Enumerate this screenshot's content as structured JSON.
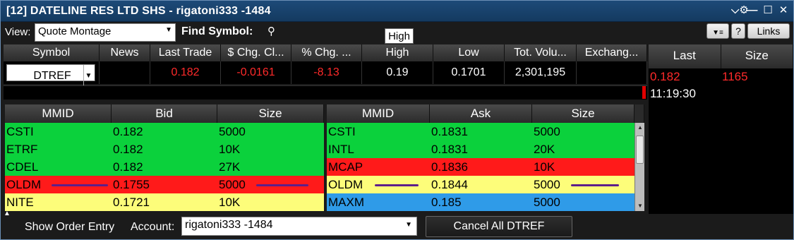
{
  "window": {
    "title": "[12] DATELINE RES LTD SHS - rigatoni333 -1484",
    "controls": [
      "gear-dropdown",
      "minimize",
      "maximize",
      "close"
    ]
  },
  "toolbar": {
    "view_label": "View:",
    "view_value": "Quote Montage",
    "find_label": "Find Symbol:",
    "help_label": "?",
    "links_label": "Links",
    "tooltip": "High"
  },
  "quote": {
    "headers": [
      "Symbol",
      "News",
      "Last Trade",
      "$ Chg. Cl...",
      "% Chg. ...",
      "High",
      "Low",
      "Tot. Volu...",
      "Exchang..."
    ],
    "symbol": "DTREF",
    "news": "",
    "last_trade": "0.182",
    "chg_dollar": "-0.0161",
    "chg_pct": "-8.13",
    "high": "0.19",
    "low": "0.1701",
    "volume": "2,301,195",
    "exchange": ""
  },
  "time_sales": {
    "headers": [
      "Last",
      "Size"
    ],
    "last": "0.182",
    "size": "1165",
    "time": "11:19:30"
  },
  "bid_table": {
    "headers": [
      "MMID",
      "Bid",
      "Size"
    ],
    "rows": [
      {
        "mmid": "CSTI",
        "price": "0.182",
        "size": "5000",
        "color": "green"
      },
      {
        "mmid": "ETRF",
        "price": "0.182",
        "size": "10K",
        "color": "green"
      },
      {
        "mmid": "CDEL",
        "price": "0.182",
        "size": "27K",
        "color": "green"
      },
      {
        "mmid": "OLDM",
        "price": "0.1755",
        "size": "5000",
        "color": "red"
      },
      {
        "mmid": "NITE",
        "price": "0.1721",
        "size": "10K",
        "color": "yellow"
      }
    ]
  },
  "ask_table": {
    "headers": [
      "MMID",
      "Ask",
      "Size"
    ],
    "rows": [
      {
        "mmid": "CSTI",
        "price": "0.1831",
        "size": "5000",
        "color": "green"
      },
      {
        "mmid": "INTL",
        "price": "0.1831",
        "size": "20K",
        "color": "green"
      },
      {
        "mmid": "MCAP",
        "price": "0.1836",
        "size": "10K",
        "color": "red"
      },
      {
        "mmid": "OLDM",
        "price": "0.1844",
        "size": "5000",
        "color": "yellow"
      },
      {
        "mmid": "MAXM",
        "price": "0.185",
        "size": "5000",
        "color": "blue"
      }
    ]
  },
  "footer": {
    "show_order_entry": "Show Order Entry",
    "account_label": "Account:",
    "account_value": "rigatoni333 -1484",
    "cancel_all": "Cancel All DTREF"
  },
  "colors": {
    "green": "#0bd13c",
    "red": "#ff1a1a",
    "yellow": "#fdfd7a",
    "blue": "#2f9be8",
    "negative_text": "#ff2a2a",
    "annotation_mark": "#5e1f8a"
  }
}
